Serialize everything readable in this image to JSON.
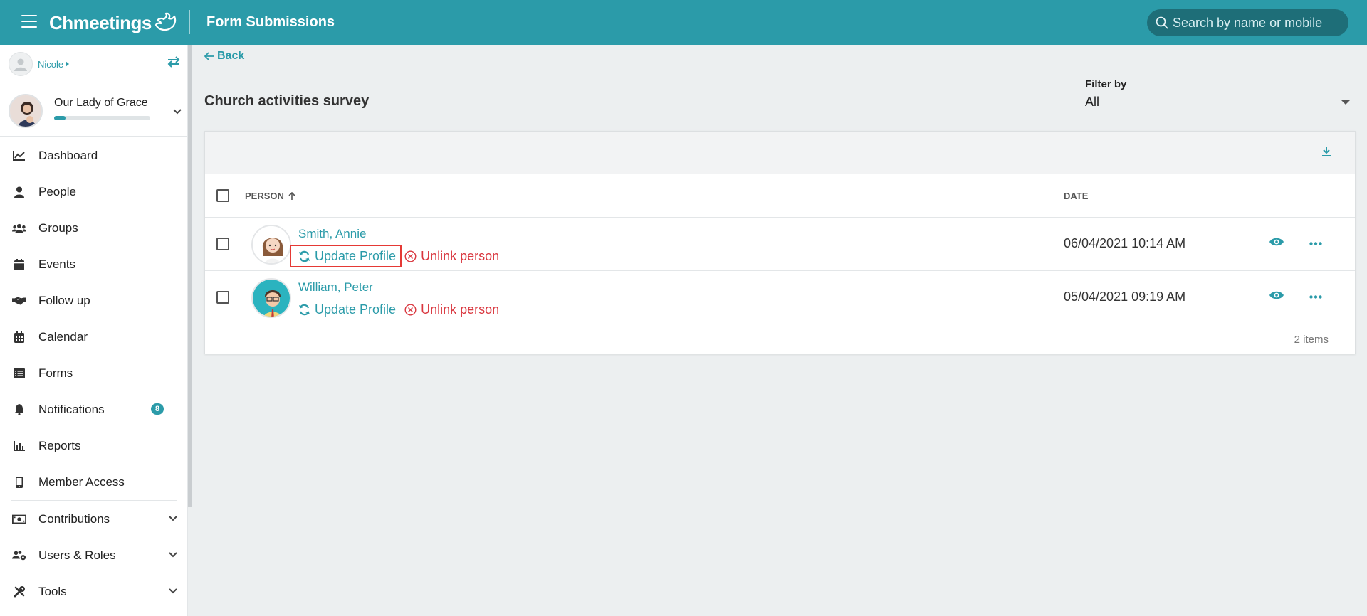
{
  "topbar": {
    "brand": "Chmeetings",
    "title": "Form Submissions",
    "search_placeholder": "Search by name or mobile"
  },
  "sidebar": {
    "user_name": "Nicole",
    "church_name": "Our Lady of Grace",
    "church_progress": 0.12,
    "items": [
      {
        "label": "Dashboard",
        "icon": "chart-line-icon"
      },
      {
        "label": "People",
        "icon": "person-icon"
      },
      {
        "label": "Groups",
        "icon": "users-icon"
      },
      {
        "label": "Events",
        "icon": "calendar-icon"
      },
      {
        "label": "Follow up",
        "icon": "handshake-icon"
      },
      {
        "label": "Calendar",
        "icon": "calendar-grid-icon"
      },
      {
        "label": "Forms",
        "icon": "list-icon"
      },
      {
        "label": "Notifications",
        "icon": "bell-icon",
        "badge": "8"
      },
      {
        "label": "Reports",
        "icon": "bar-chart-icon"
      },
      {
        "label": "Member Access",
        "icon": "mobile-icon"
      },
      {
        "label": "Contributions",
        "icon": "money-icon"
      },
      {
        "label": "Users & Roles",
        "icon": "users-cog-icon"
      },
      {
        "label": "Tools",
        "icon": "tools-icon"
      }
    ]
  },
  "main": {
    "back_label": "Back",
    "survey_title": "Church activities survey",
    "filter_label": "Filter by",
    "filter_value": "All",
    "columns": {
      "person": "PERSON",
      "date": "DATE"
    },
    "rows": [
      {
        "name": "Smith, Annie",
        "update": "Update Profile",
        "unlink": "Unlink person",
        "date": "06/04/2021 10:14 AM"
      },
      {
        "name": "William, Peter",
        "update": "Update Profile",
        "unlink": "Unlink person",
        "date": "05/04/2021 09:19 AM"
      }
    ],
    "items_count": "2 items"
  },
  "colors": {
    "accent": "#2b9ba9",
    "danger": "#d9363e",
    "highlight": "#e53935"
  }
}
